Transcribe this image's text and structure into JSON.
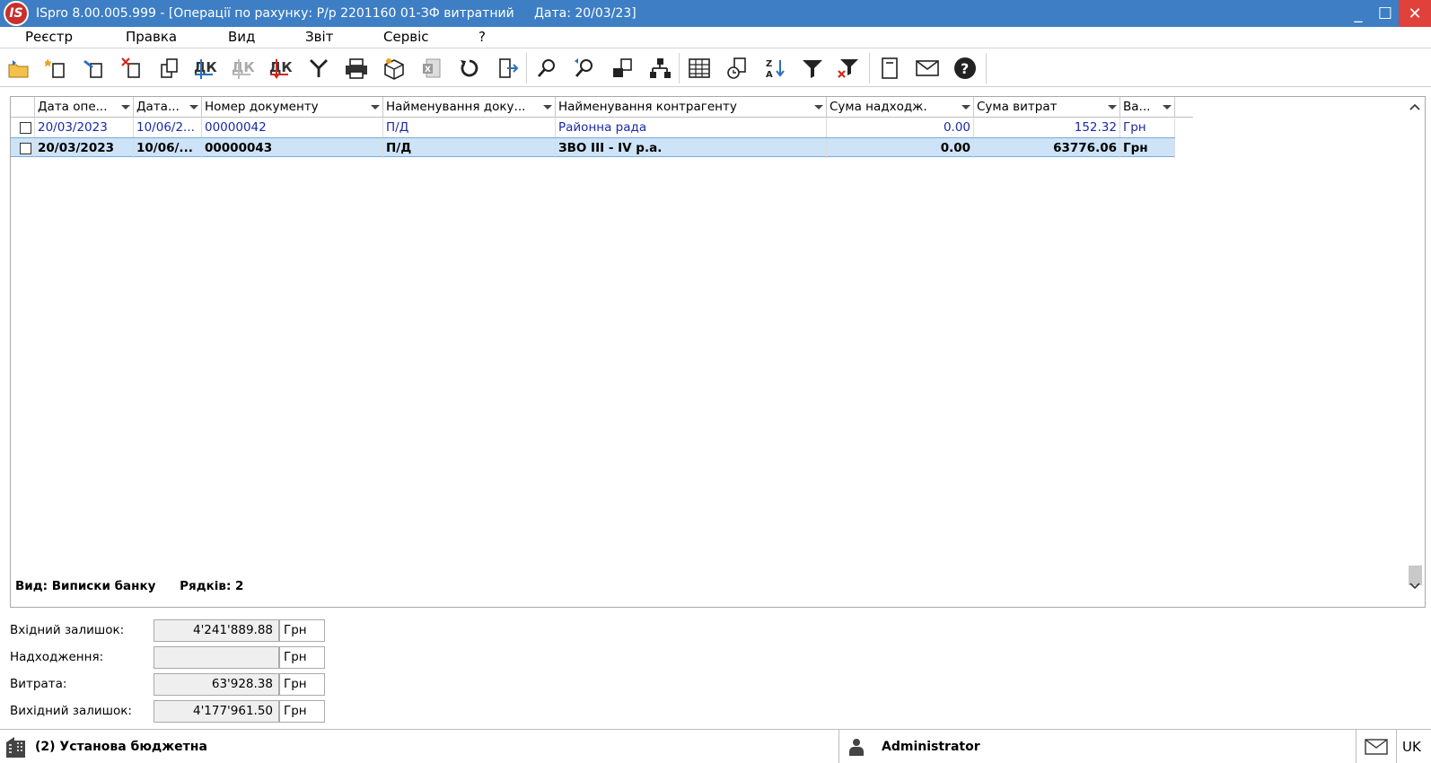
{
  "window": {
    "app_logo": "IS",
    "title": "ISpro 8.00.005.999 - [Операції по рахунку: Р/р 2201160 01-ЗФ витратний     Дата: 20/03/23]",
    "controls": {
      "minimize": "_",
      "maximize": "☐",
      "close": "✕"
    }
  },
  "menu": {
    "items": [
      "Реєстр",
      "Правка",
      "Вид",
      "Звіт",
      "Сервіс",
      "?"
    ]
  },
  "toolbar": {
    "icons": [
      "open-folder-icon",
      "new-document-icon",
      "edit-document-icon",
      "delete-document-icon",
      "copy-document-icon",
      "dk-icon",
      "dk-disabled-icon",
      "dk-red-icon",
      "merge-arrow-icon",
      "print-icon",
      "package-icon",
      "excel-icon",
      "refresh-icon",
      "exit-icon",
      "search-icon",
      "search-next-icon",
      "transfer-icon",
      "hierarchy-icon",
      "table-icon",
      "history-icon",
      "sort-az-icon",
      "filter-icon",
      "clear-filter-icon",
      "notepad-icon",
      "mail-icon",
      "help-icon"
    ]
  },
  "grid": {
    "columns": [
      "Дата опе...",
      "Дата...",
      "Номер документу",
      "Найменування доку...",
      "Найменування контрагенту",
      "Сума надходж.",
      "Сума витрат",
      "Ва..."
    ],
    "rows": [
      {
        "date_op": "20/03/2023",
        "date_doc": "10/06/2...",
        "doc_number": "00000042",
        "doc_name": "П/Д",
        "counterparty": "Районна рада",
        "income": "0.00",
        "expense": "152.32",
        "currency": "Грн",
        "selected": false
      },
      {
        "date_op": "20/03/2023",
        "date_doc": "10/06/...",
        "doc_number": "00000043",
        "doc_name": "П/Д",
        "counterparty": "ЗВО III - IV р.а.",
        "income": "0.00",
        "expense": "63776.06",
        "currency": "Грн",
        "selected": true
      }
    ],
    "status": {
      "view": "Вид: Виписки банку",
      "rows": "Рядків: 2"
    }
  },
  "balances": {
    "opening_label": "Вхідний залишок:",
    "opening_value": "4'241'889.88",
    "income_label": "Надходження:",
    "income_value": "",
    "expense_label": "Витрата:",
    "expense_value": "63'928.38",
    "closing_label": "Вихідний залишок:",
    "closing_value": "4'177'961.50",
    "currency": "Грн"
  },
  "statusbar": {
    "organization": "(2) Установа бюджетна",
    "user": "Administrator",
    "language": "UK"
  },
  "colors": {
    "title_bar": "#3d7ec4",
    "selection": "#cde3f7",
    "link_text": "#1a2aa8",
    "close_button": "#e0413b"
  }
}
